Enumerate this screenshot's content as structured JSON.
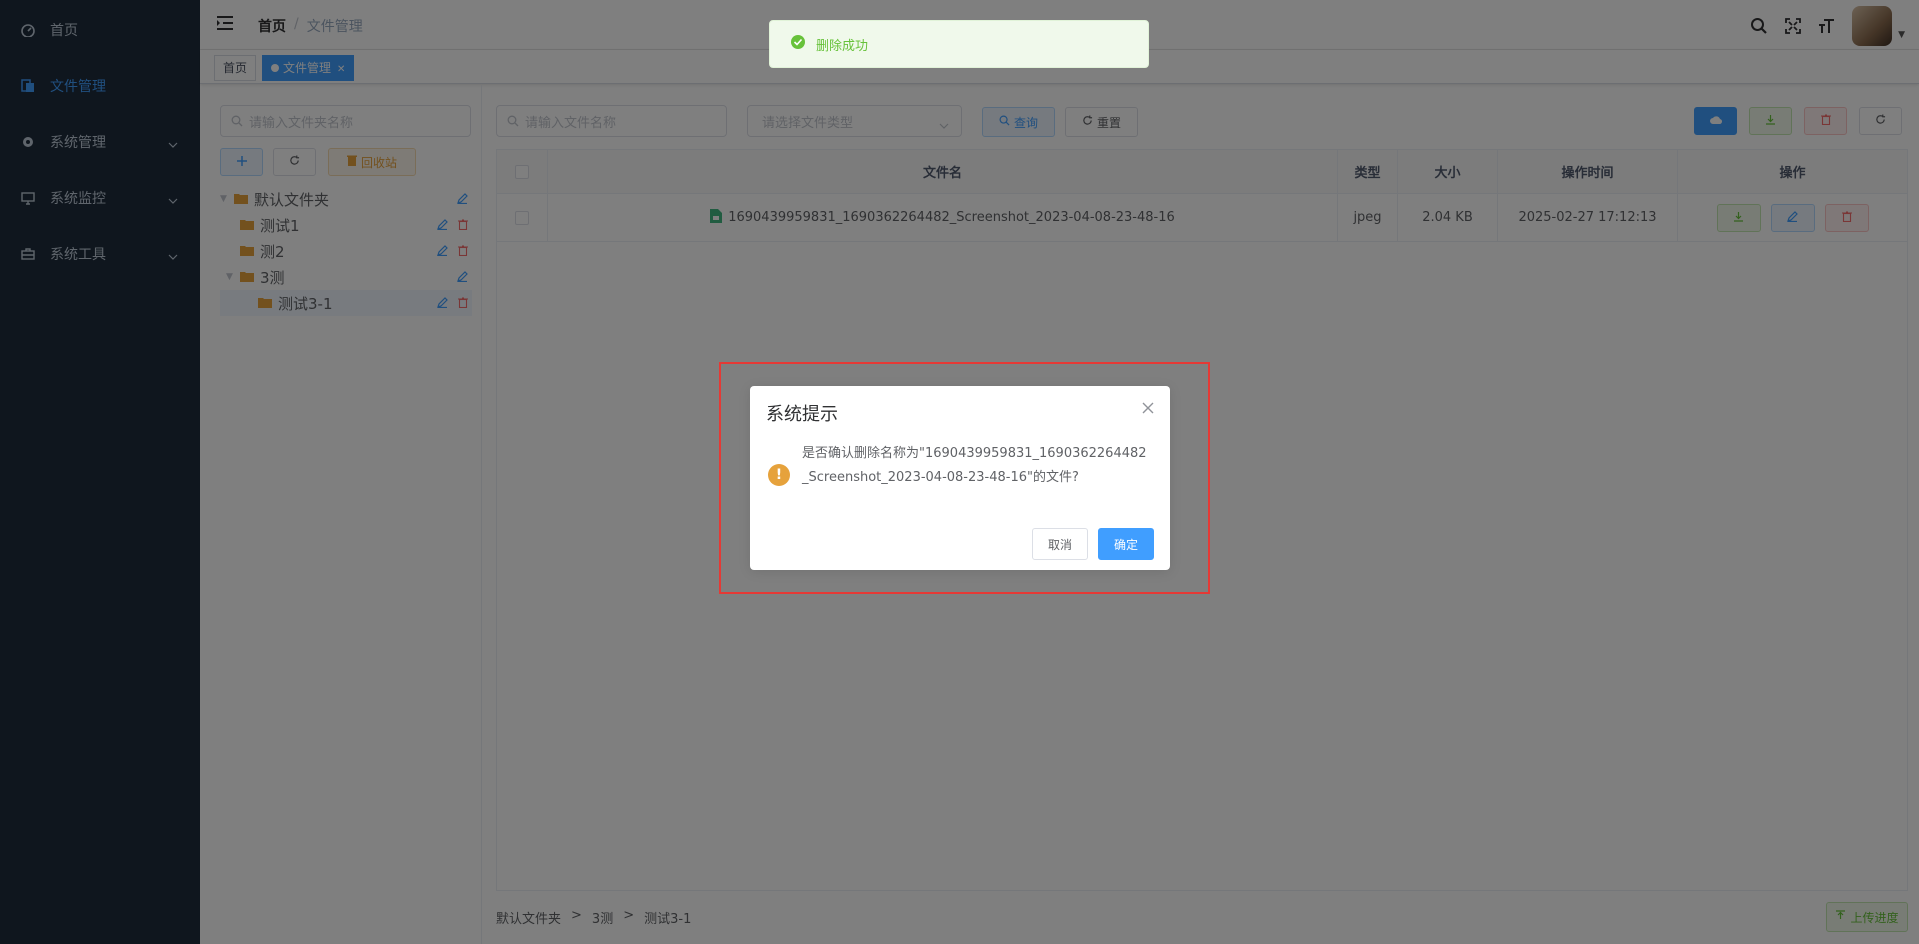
{
  "sidebar": {
    "items": [
      {
        "label": "首页",
        "icon": "dashboard-icon"
      },
      {
        "label": "文件管理",
        "icon": "file-icon"
      },
      {
        "label": "系统管理",
        "icon": "gear-icon"
      },
      {
        "label": "系统监控",
        "icon": "monitor-icon"
      },
      {
        "label": "系统工具",
        "icon": "toolbox-icon"
      }
    ]
  },
  "navbar": {
    "breadcrumb": [
      "首页",
      "/",
      "文件管理"
    ]
  },
  "tags": [
    "首页",
    "文件管理"
  ],
  "toast": {
    "message": "删除成功"
  },
  "tree": {
    "search_placeholder": "请输入文件夹名称",
    "recycle_label": "回收站",
    "nodes": [
      {
        "label": "默认文件夹"
      },
      {
        "label": "测试1"
      },
      {
        "label": "测2"
      },
      {
        "label": "3测"
      },
      {
        "label": "测试3-1"
      }
    ]
  },
  "filters": {
    "file_name_placeholder": "请输入文件名称",
    "file_type_placeholder": "请选择文件类型",
    "query_label": "查询",
    "reset_label": "重置"
  },
  "table": {
    "columns": [
      "文件名",
      "类型",
      "大小",
      "操作时间",
      "操作"
    ],
    "rows": [
      {
        "name": "1690439959831_1690362264482_Screenshot_2023-04-08-23-48-16",
        "type": "jpeg",
        "size": "2.04 KB",
        "time": "2025-02-27 17:12:13"
      }
    ]
  },
  "footer": {
    "path": [
      "默认文件夹",
      ">",
      "3测",
      ">",
      "测试3-1"
    ],
    "upload_progress_label": "上传进度"
  },
  "dialog": {
    "title": "系统提示",
    "message": "是否确认删除名称为\"1690439959831_1690362264482_Screenshot_2023-04-08-23-48-16\"的文件?",
    "cancel_label": "取消",
    "confirm_label": "确定"
  },
  "colors": {
    "primary": "#409eff",
    "sidebar_bg": "#1f2d3d",
    "warning": "#e6a23c",
    "success": "#67c23a",
    "danger": "#f56c6c"
  }
}
